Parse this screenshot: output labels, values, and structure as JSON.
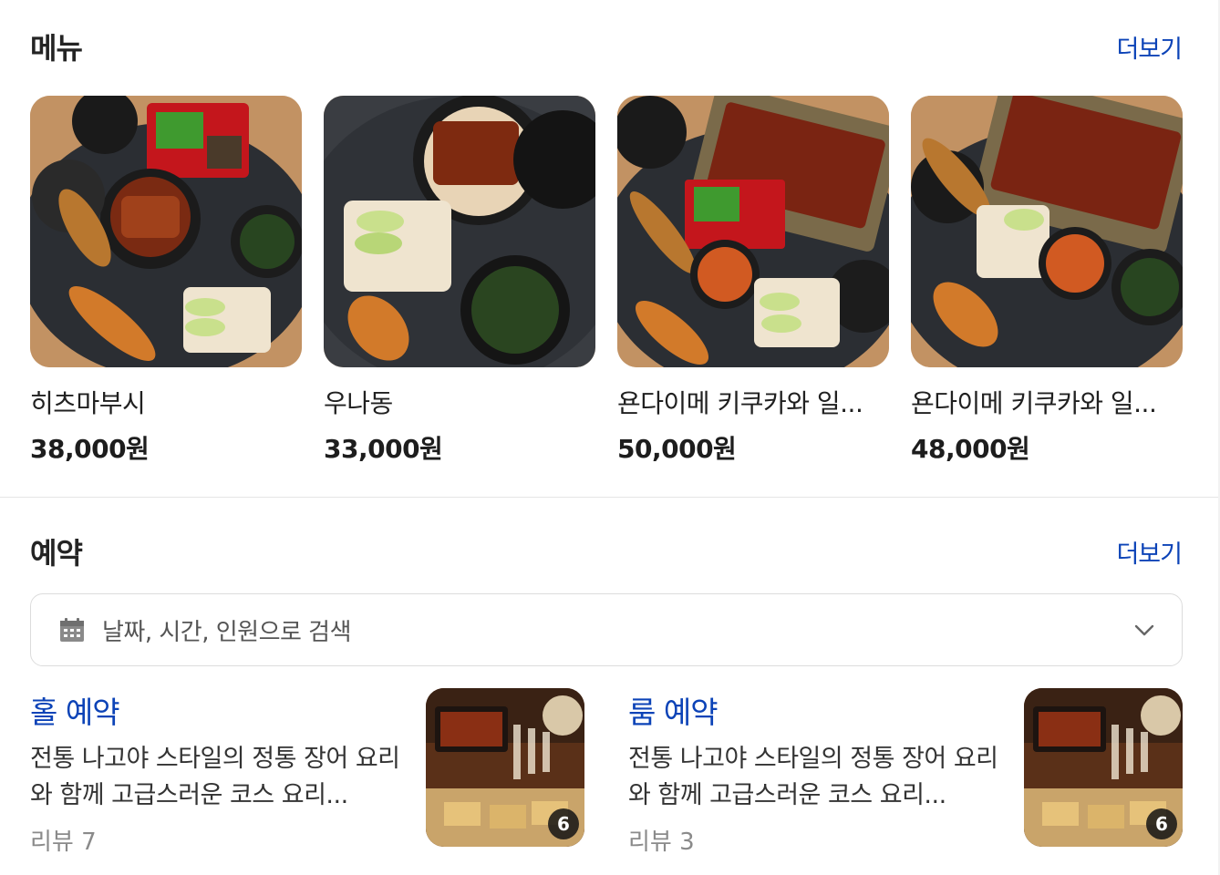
{
  "menu": {
    "title": "메뉴",
    "more_label": "더보기",
    "items": [
      {
        "name": "히츠마부시",
        "price": "38,000원"
      },
      {
        "name": "우나동",
        "price": "33,000원"
      },
      {
        "name": "욘다이메 키쿠카와 일...",
        "price": "50,000원"
      },
      {
        "name": "욘다이메 키쿠카와 일...",
        "price": "48,000원"
      }
    ]
  },
  "reservation": {
    "title": "예약",
    "more_label": "더보기",
    "search_placeholder": "날짜, 시간, 인원으로 검색",
    "options": [
      {
        "title": "홀 예약",
        "description": "전통 나고야 스타일의 정통 장어 요리와 함께 고급스러운 코스 요리...",
        "reviews": "리뷰 7",
        "photo_count": "6"
      },
      {
        "title": "룸 예약",
        "description": "전통 나고야 스타일의 정통 장어 요리와 함께 고급스러운 코스 요리...",
        "reviews": "리뷰 3",
        "photo_count": "6"
      }
    ]
  },
  "icons": {
    "calendar": "calendar-icon",
    "chevron": "chevron-down-icon"
  },
  "colors": {
    "link": "#0c43b7",
    "divider": "#e6e6e6",
    "border": "#dcdcdc"
  }
}
